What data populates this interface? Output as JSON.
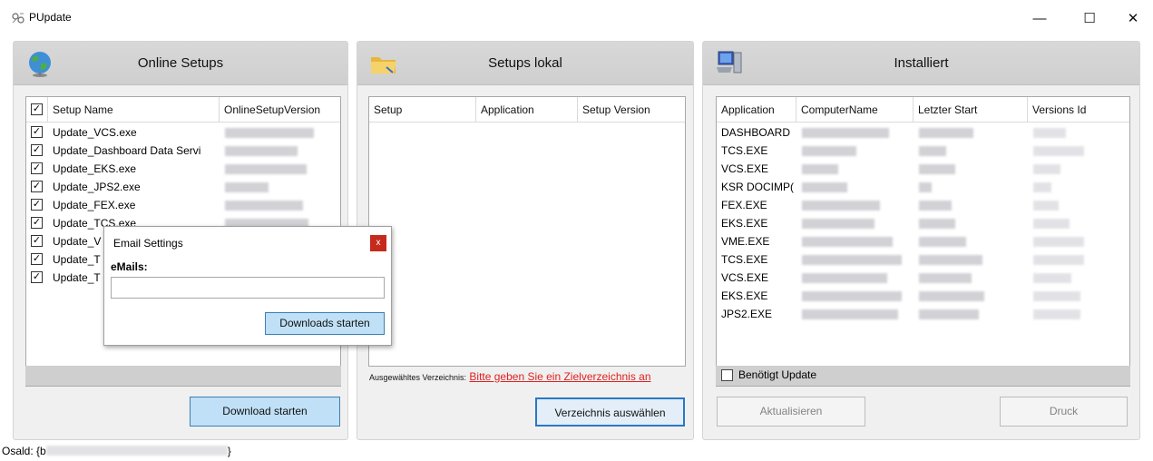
{
  "window": {
    "title": "PUpdate",
    "minimize": "—",
    "maximize": "☐",
    "close": "✕"
  },
  "panels": {
    "online": {
      "title": "Online Setups",
      "columns": [
        "",
        "Setup Name",
        "OnlineSetupVersion"
      ],
      "rows": [
        {
          "checked": true,
          "name": "Update_VCS.exe"
        },
        {
          "checked": true,
          "name": "Update_Dashboard Data Servi"
        },
        {
          "checked": true,
          "name": "Update_EKS.exe"
        },
        {
          "checked": true,
          "name": "Update_JPS2.exe"
        },
        {
          "checked": true,
          "name": "Update_FEX.exe"
        },
        {
          "checked": true,
          "name": "Update_TCS.exe"
        },
        {
          "checked": true,
          "name": "Update_V"
        },
        {
          "checked": true,
          "name": "Update_T"
        },
        {
          "checked": true,
          "name": "Update_T"
        }
      ],
      "button": "Download starten"
    },
    "local": {
      "title": "Setups lokal",
      "columns": [
        "Setup",
        "Application",
        "Setup Version"
      ],
      "dir_label": "Ausgewähltes Verzeichnis:",
      "dir_link": "Bitte geben Sie ein Zielverzeichnis an",
      "button": "Verzeichnis auswählen"
    },
    "installed": {
      "title": "Installiert",
      "columns": [
        "Application",
        "ComputerName",
        "Letzter Start",
        "Versions Id"
      ],
      "rows": [
        "DASHBOARD",
        "TCS.EXE",
        "VCS.EXE",
        "KSR DOCIMP(",
        "FEX.EXE",
        "EKS.EXE",
        "VME.EXE",
        "TCS.EXE",
        "VCS.EXE",
        "EKS.EXE",
        "JPS2.EXE"
      ],
      "checkbox_label": "Benötigt Update",
      "checkbox_checked": false,
      "refresh_button": "Aktualisieren",
      "print_button": "Druck"
    }
  },
  "dialog": {
    "title": "Email Settings",
    "close": "x",
    "label": "eMails:",
    "value": "",
    "button": "Downloads starten"
  },
  "status": {
    "text": "Osald: {b",
    "closing": "}"
  }
}
